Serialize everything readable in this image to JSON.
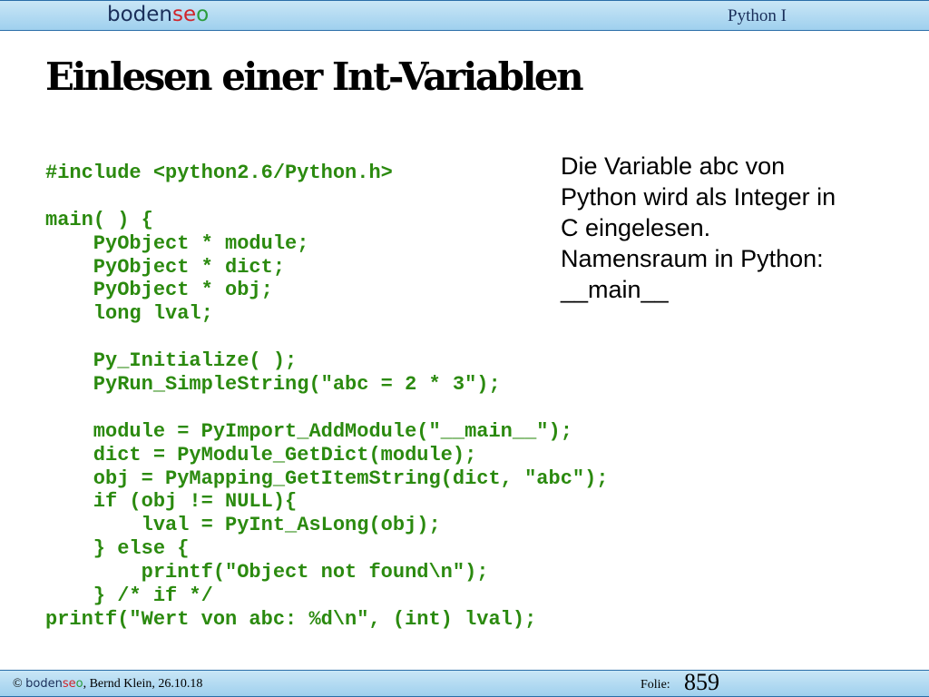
{
  "header": {
    "logo_part1": "boden",
    "logo_part2": "se",
    "logo_part3": "o",
    "course": "Python I"
  },
  "slide": {
    "title": "Einlesen einer Int-Variablen",
    "code_lines": [
      "#include <python2.6/Python.h>",
      "",
      "main( ) {",
      "    PyObject * module;",
      "    PyObject * dict;",
      "    PyObject * obj;",
      "    long lval;",
      "",
      "    Py_Initialize( );",
      "    PyRun_SimpleString(\"abc = 2 * 3\");",
      "",
      "    module = PyImport_AddModule(\"__main__\");",
      "    dict = PyModule_GetDict(module);",
      "    obj = PyMapping_GetItemString(dict, \"abc\");",
      "    if (obj != NULL){",
      "        lval = PyInt_AsLong(obj);",
      "    } else {",
      "        printf(\"Object not found\\n\");",
      "    } /* if */",
      "printf(\"Wert von abc: %d\\n\", (int) lval);"
    ],
    "description_lines": [
      "Die Variable abc von",
      "Python wird als Integer in",
      "C eingelesen.",
      "Namensraum in Python:",
      "__main__"
    ]
  },
  "footer": {
    "copyright": "©",
    "logo_part1": "boden",
    "logo_part2": "se",
    "logo_part3": "o",
    "author_date": ", Bernd Klein, 26.10.18",
    "folie_label": "Folie:",
    "folie_number": "859"
  },
  "colors": {
    "bar": "#a9d6f0",
    "bar_border": "#2a6ea8",
    "code": "#2b8a0f",
    "logo_dark": "#1a2f5a",
    "logo_red": "#d0242a",
    "logo_green": "#2a9c3c"
  }
}
